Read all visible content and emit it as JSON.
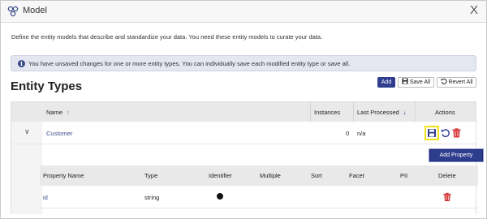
{
  "window": {
    "title": "Model",
    "close_label": "X"
  },
  "description": "Define the entity models that describe and standardize your data. You need these entity models to curate your data.",
  "alert": {
    "icon": "info-icon",
    "icon_glyph": "i",
    "text": "You have unsaved changes for one or more entity types. You can individually save each modified entity type or save all."
  },
  "section_title": "Entity Types",
  "toolbar": {
    "add_label": "Add",
    "save_all_label": "Save All",
    "revert_all_label": "Revert All"
  },
  "table": {
    "headers": {
      "name": "Name",
      "instances": "Instances",
      "last_processed": "Last Processed",
      "actions": "Actions"
    },
    "rows": [
      {
        "name": "Customer",
        "instances": "0",
        "last_processed": "n/a",
        "expand_glyph": "∨"
      }
    ]
  },
  "properties": {
    "add_property_label": "Add Property",
    "headers": {
      "property_name": "Property Name",
      "type": "Type",
      "identifier": "Identifier",
      "multiple": "Multiple",
      "sort": "Sort",
      "facet": "Facet",
      "pii": "PII",
      "delete": "Delete"
    },
    "rows": [
      {
        "name": "id",
        "type": "string",
        "identifier": true
      }
    ]
  },
  "colors": {
    "accent": "#2f3d8e",
    "link": "#3b4d8a",
    "delete": "#d32f2f",
    "highlight": "#f1e01a"
  }
}
